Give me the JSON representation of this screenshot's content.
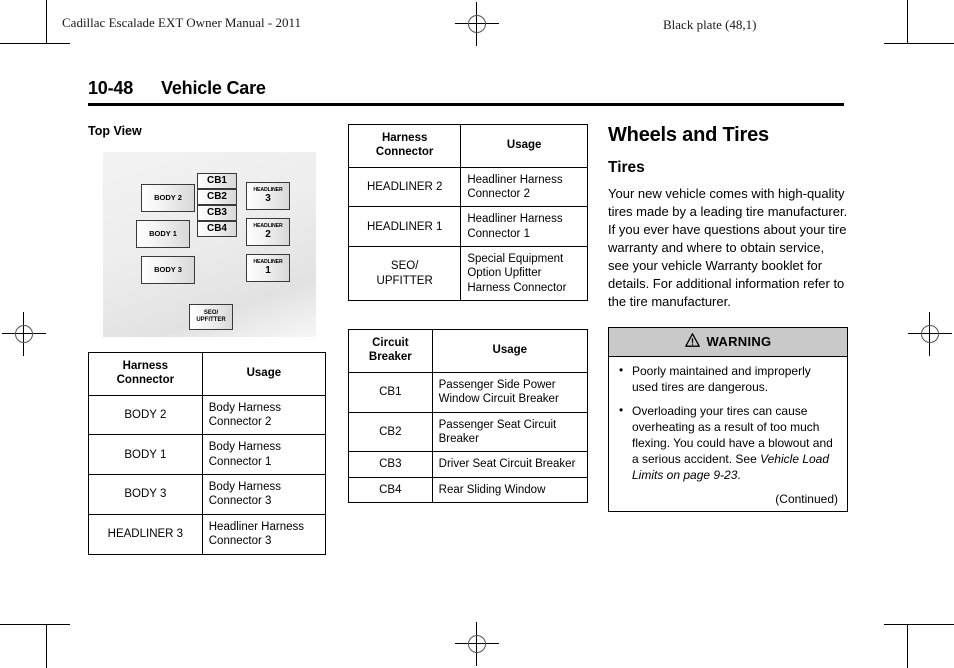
{
  "header": {
    "manual_title": "Cadillac Escalade EXT Owner Manual - 2011",
    "black_plate": "Black plate (48,1)",
    "page_number": "10-48",
    "section_title": "Vehicle Care"
  },
  "left_column": {
    "diagram_label": "Top View",
    "diagram": {
      "body_boxes": [
        {
          "label": "BODY 2"
        },
        {
          "label": "BODY 1"
        },
        {
          "label": "BODY 3"
        }
      ],
      "circuit_breakers": [
        {
          "label": "CB1"
        },
        {
          "label": "CB2"
        },
        {
          "label": "CB3"
        },
        {
          "label": "CB4"
        }
      ],
      "headliners": [
        {
          "top": "HEADLINER",
          "num": "3"
        },
        {
          "top": "HEADLINER",
          "num": "2"
        },
        {
          "top": "HEADLINER",
          "num": "1"
        }
      ],
      "seo_box": {
        "line1": "SEO/",
        "line2": "UPFITTER"
      }
    },
    "harness_table": {
      "headers": [
        "Harness\nConnector",
        "Usage"
      ],
      "header_col1_line1": "Harness",
      "header_col1_line2": "Connector",
      "header_col2": "Usage",
      "rows": [
        {
          "connector": "BODY 2",
          "usage": "Body Harness Connector 2"
        },
        {
          "connector": "BODY 1",
          "usage": "Body Harness Connector 1"
        },
        {
          "connector": "BODY 3",
          "usage": "Body Harness Connector 3"
        },
        {
          "connector": "HEADLINER 3",
          "usage": "Headliner Harness Connector 3"
        }
      ]
    }
  },
  "middle_column": {
    "harness_table": {
      "header_col1_line1": "Harness",
      "header_col1_line2": "Connector",
      "header_col2": "Usage",
      "rows": [
        {
          "connector": "HEADLINER 2",
          "usage": "Headliner Harness Connector 2"
        },
        {
          "connector": "HEADLINER 1",
          "usage": "Headliner Harness Connector 1"
        },
        {
          "connector": "SEO/ UPFITTER",
          "connector_line1": "SEO/",
          "connector_line2": "UPFITTER",
          "usage": "Special Equipment Option Upfitter Harness Connector"
        }
      ]
    },
    "circuit_breaker_table": {
      "header_col1_line1": "Circuit",
      "header_col1_line2": "Breaker",
      "header_col2": "Usage",
      "rows": [
        {
          "breaker": "CB1",
          "usage": "Passenger Side Power Window Circuit Breaker"
        },
        {
          "breaker": "CB2",
          "usage": "Passenger Seat Circuit Breaker"
        },
        {
          "breaker": "CB3",
          "usage": "Driver Seat Circuit Breaker"
        },
        {
          "breaker": "CB4",
          "usage": "Rear Sliding Window"
        }
      ]
    }
  },
  "right_column": {
    "heading": "Wheels and Tires",
    "subheading": "Tires",
    "paragraph": "Your new vehicle comes with high-quality tires made by a leading tire manufacturer. If you ever have questions about your tire warranty and where to obtain service, see your vehicle Warranty booklet for details. For additional information refer to the tire manufacturer.",
    "warning": {
      "title": "WARNING",
      "icon": "warning-triangle-icon",
      "items": [
        {
          "text": "Poorly maintained and improperly used tires are dangerous."
        },
        {
          "text_before": "Overloading your tires can cause overheating as a result of too much flexing. You could have a blowout and a serious accident. See ",
          "text_italic": "Vehicle Load Limits on page 9-23",
          "text_after": "."
        }
      ],
      "continued": "(Continued)"
    }
  },
  "colors": {
    "warning_header_bg": "#c9c9c9",
    "diagram_bg": "#ededed",
    "rule": "#000000"
  }
}
